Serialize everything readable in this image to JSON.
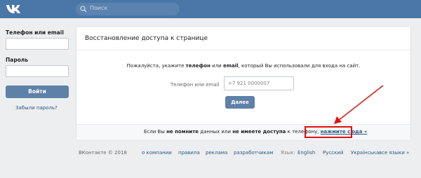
{
  "header": {
    "search_placeholder": "Поиск"
  },
  "sidebar": {
    "phone_label": "Телефон или email",
    "password_label": "Пароль",
    "login_button": "Войти",
    "forgot_link": "Забыли пароль?"
  },
  "card": {
    "title": "Восстановление доступа к странице",
    "instruction_parts": [
      "Пожалуйста, укажите ",
      "телефон",
      " или ",
      "email",
      ", который Вы использовали для входа на сайт."
    ],
    "field_label": "Телефон или email",
    "field_placeholder": "+7 921 0000007",
    "next_button": "Далее",
    "footer_parts": [
      "Если Вы ",
      "не помните",
      " данных или ",
      "не имеете доступа",
      " к телефону, ",
      "нажмите сюда »"
    ]
  },
  "footer": {
    "copyright": "ВКонтакте © 2018",
    "links": [
      "о компании",
      "правила",
      "реклама",
      "разработчикам"
    ],
    "language_label": "Язык:",
    "languages": [
      "English",
      "Русский",
      "Українська",
      "все языки »"
    ]
  },
  "colors": {
    "header_bg": "#4a76a8",
    "button_bg": "#5e81a8",
    "link": "#2a5885",
    "annotation_red": "#e01010"
  }
}
